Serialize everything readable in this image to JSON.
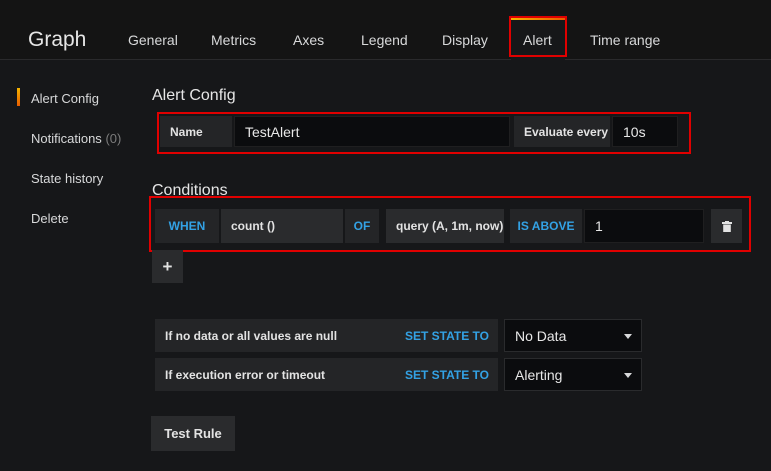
{
  "header": {
    "title": "Graph",
    "tabs": [
      {
        "label": "General"
      },
      {
        "label": "Metrics"
      },
      {
        "label": "Axes"
      },
      {
        "label": "Legend"
      },
      {
        "label": "Display"
      },
      {
        "label": "Alert"
      },
      {
        "label": "Time range"
      }
    ],
    "active_tab": "Alert"
  },
  "sidebar": {
    "items": [
      {
        "label": "Alert Config"
      },
      {
        "label": "Notifications",
        "count": "(0)"
      },
      {
        "label": "State history"
      },
      {
        "label": "Delete"
      }
    ],
    "active_item": "Alert Config"
  },
  "alert_config": {
    "section_title": "Alert Config",
    "name_label": "Name",
    "name_value": "TestAlert",
    "evaluate_label": "Evaluate every",
    "evaluate_value": "10s"
  },
  "conditions": {
    "section_title": "Conditions",
    "when": "WHEN",
    "reducer": "count ()",
    "of": "OF",
    "query": "query (A, 1m, now)",
    "evaluator": "IS ABOVE",
    "threshold": "1",
    "add_button": "+"
  },
  "state_rules": [
    {
      "label": "If no data or all values are null",
      "action": "SET STATE TO",
      "value": "No Data"
    },
    {
      "label": "If execution error or timeout",
      "action": "SET STATE TO",
      "value": "Alerting"
    }
  ],
  "test_rule_button": "Test Rule",
  "colors": {
    "highlight_border": "#e00000",
    "keyword_blue": "#33a2e5",
    "accent_orange": "#f5b400"
  }
}
